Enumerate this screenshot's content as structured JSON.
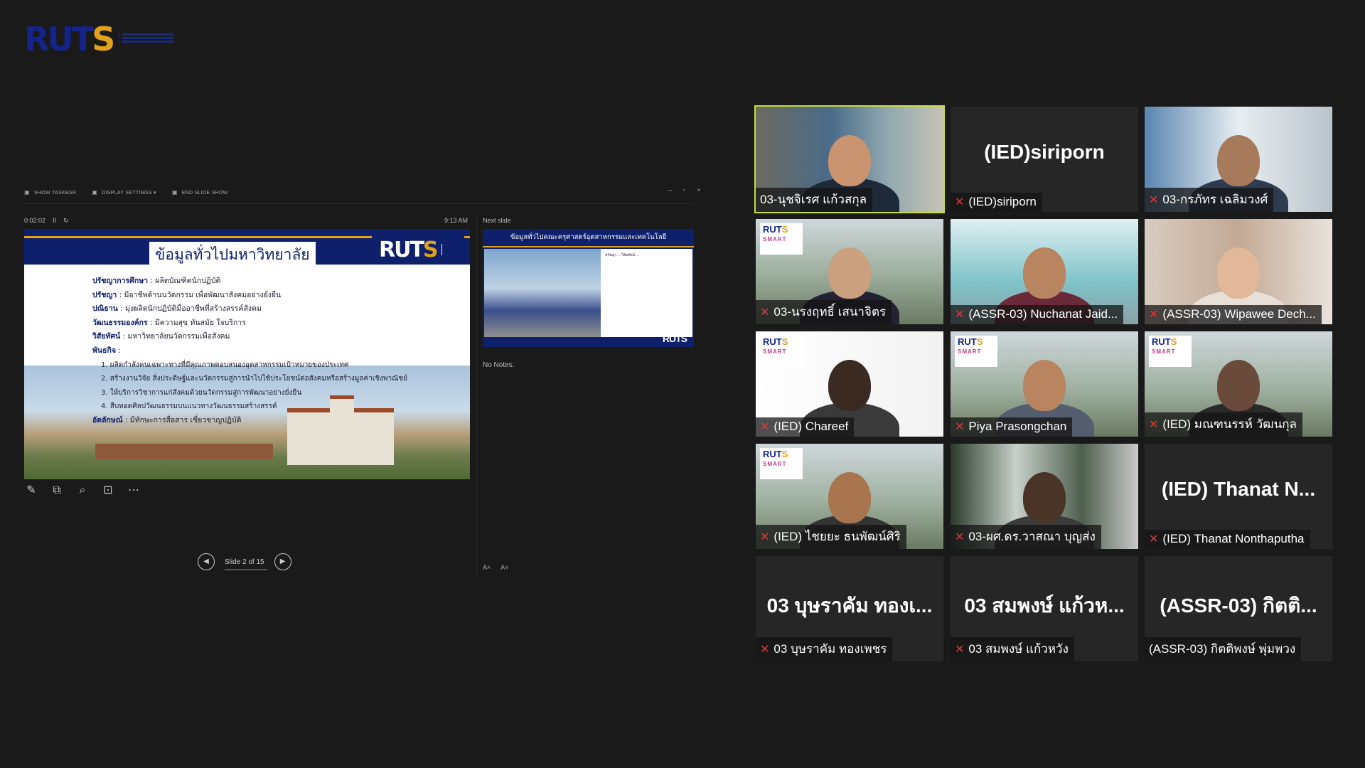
{
  "brand": {
    "logo_text": "RUTS",
    "accent": "#e0a11b",
    "navy": "#14248a"
  },
  "presenter": {
    "toolbar": [
      "SHOW TASKBAR",
      "DISPLAY SETTINGS ▾",
      "END SLIDE SHOW"
    ],
    "window_controls": [
      "–",
      "▫",
      "×"
    ],
    "timer": "0:02:02",
    "timer_pause": "II",
    "timer_reset": "↻",
    "clock": "9:13 AM",
    "next_slide_label": "Next slide",
    "notes": "No Notes.",
    "slide_counter": "Slide 2 of 15",
    "prev": "◀",
    "next": "▶",
    "font_buttons": [
      "A˄",
      "A˅"
    ],
    "tools": [
      "✎",
      "⧉",
      "⌕",
      "⊡",
      "⋯"
    ]
  },
  "current_slide": {
    "title": "ข้อมูลทั่วไปมหาวิทยาลัย",
    "logo": "RUTS",
    "lines": [
      {
        "label": "ปรัชญาการศึกษา",
        "text": " : ผลิตบัณฑิตนักปฏิบัติ"
      },
      {
        "label": "ปรัชญา",
        "text": " : มีอาชีพด้านนวัตกรรม เพื่อพัฒนาสังคมอย่างยั่งยืน"
      },
      {
        "label": "ปณิธาน",
        "text": " : มุ่งผลิตนักปฏิบัติมืออาชีพที่สร้างสรรค์สังคม"
      },
      {
        "label": "วัฒนธรรมองค์กร",
        "text": " : มีความสุข ทันสมัย ใจบริการ"
      },
      {
        "label": "วิสัยทัศน์",
        "text": " : มหาวิทยาลัยนวัตกรรมเพื่อสังคม"
      },
      {
        "label": "พันธกิจ",
        "text": " :"
      }
    ],
    "missions": [
      "1. ผลิตกำลังคนเฉพาะทางที่มีคุณภาพตอบสนองอุตสาหกรรมเป้าหมายของประเทศ",
      "2. สร้างงานวิจัย สิ่งประดิษฐ์และนวัตกรรมสู่การนำไปใช้ประโยชน์ต่อสังคมหรือสร้างมูลค่าเชิงพาณิชย์",
      "3. ให้บริการวิชาการแก่สังคมด้วยนวัตกรรมสู่การพัฒนาอย่างยั่งยืน",
      "4. สืบทอดศิลปวัฒนธรรมบนแนวทางวัฒนธรรมสร้างสรรค์"
    ],
    "identity": {
      "label": "อัตลักษณ์",
      "text": " : มีทักษะการสื่อสาร เชี่ยวชาญปฏิบัติ"
    }
  },
  "next_slide": {
    "title": "ข้อมูลทั่วไปคณะครุศาสตร์อุตสาหกรรมและเทคโนโลยี",
    "text": "ปรัชญา ... วิสัยทัศน์ ...",
    "logo": "RUTS"
  },
  "participants": [
    {
      "name": "03-นุชจิเรศ  แก้วสกุล",
      "video": true,
      "muted": false,
      "active": true
    },
    {
      "name": "(IED)siriporn",
      "big": "(IED)siriporn",
      "video": false,
      "muted": true
    },
    {
      "name": "03-กรภัทร เฉลิมวงศ์",
      "video": true,
      "muted": true
    },
    {
      "name": "03-นรงฤทธิ์ เสนาจิตร",
      "video": true,
      "muted": true
    },
    {
      "name": "(ASSR-03) Nuchanat Jaid...",
      "video": true,
      "muted": true
    },
    {
      "name": "(ASSR-03) Wipawee Dech...",
      "video": true,
      "muted": true
    },
    {
      "name": "(IED) Chareef",
      "video": true,
      "muted": true
    },
    {
      "name": "Piya Prasongchan",
      "video": true,
      "muted": true
    },
    {
      "name": "(IED) มณฑนรรห์ วัฒนกุล",
      "video": true,
      "muted": true
    },
    {
      "name": "(IED) ไชยยะ ธนพัฒน์ศิริ",
      "video": true,
      "muted": true
    },
    {
      "name": "03-ผศ.ดร.วาสณา บุญส่ง",
      "video": true,
      "muted": true
    },
    {
      "name": "(IED) Thanat Nonthaputha",
      "big": "(IED)  Thanat  N...",
      "video": false,
      "muted": true
    },
    {
      "name": "03 บุษราคัม ทองเพชร",
      "big": "03 บุษราคัม ทองเ...",
      "video": false,
      "muted": true
    },
    {
      "name": "03 สมพงษ์ แก้วหวัง",
      "big": "03 สมพงษ์ แก้วห...",
      "video": false,
      "muted": true
    },
    {
      "name": "(ASSR-03) กิตติพงษ์ พุ่มพวง",
      "big": "(ASSR-03) กิตติ...",
      "video": false,
      "muted": false
    }
  ]
}
